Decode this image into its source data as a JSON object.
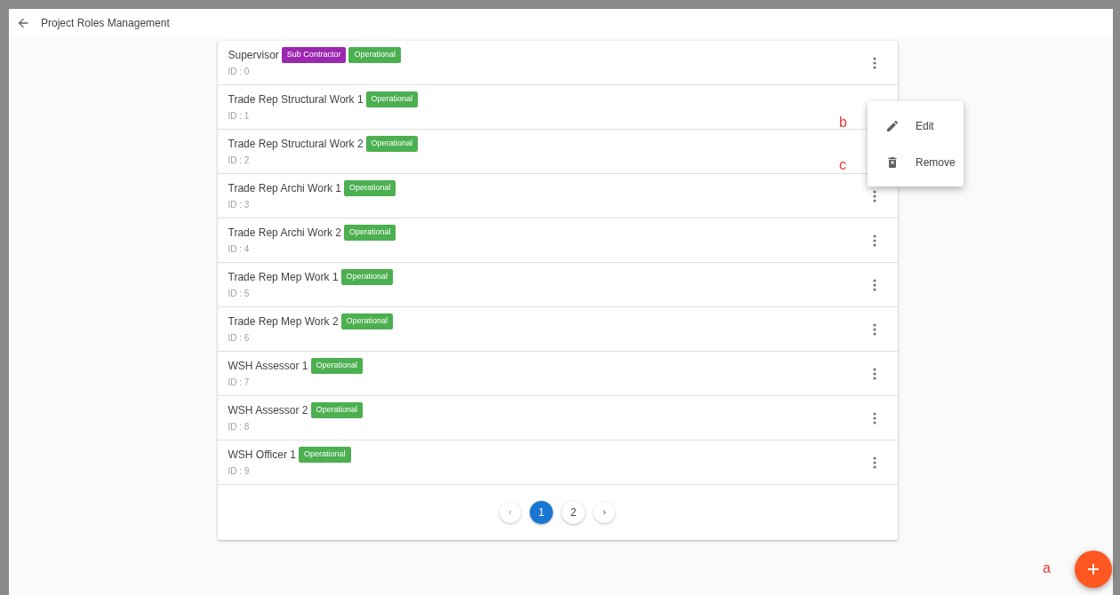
{
  "header": {
    "title": "Project Roles Management"
  },
  "roles": [
    {
      "name": "Supervisor",
      "id_label": "ID : 0",
      "kebab_visible": true,
      "tags": [
        {
          "label": "Sub Contractor",
          "color": "#9c27b0"
        },
        {
          "label": "Operational",
          "color": "#4caf50"
        }
      ]
    },
    {
      "name": "Trade Rep Structural Work 1",
      "id_label": "ID : 1",
      "kebab_visible": false,
      "tags": [
        {
          "label": "Operational",
          "color": "#4caf50"
        }
      ]
    },
    {
      "name": "Trade Rep Structural Work 2",
      "id_label": "ID : 2",
      "kebab_visible": false,
      "tags": [
        {
          "label": "Operational",
          "color": "#4caf50"
        }
      ]
    },
    {
      "name": "Trade Rep Archi Work 1",
      "id_label": "ID : 3",
      "kebab_visible": true,
      "tags": [
        {
          "label": "Operational",
          "color": "#4caf50"
        }
      ]
    },
    {
      "name": "Trade Rep Archi Work 2",
      "id_label": "ID : 4",
      "kebab_visible": true,
      "tags": [
        {
          "label": "Operational",
          "color": "#4caf50"
        }
      ]
    },
    {
      "name": "Trade Rep Mep Work 1",
      "id_label": "ID : 5",
      "kebab_visible": true,
      "tags": [
        {
          "label": "Operational",
          "color": "#4caf50"
        }
      ]
    },
    {
      "name": "Trade Rep Mep Work 2",
      "id_label": "ID : 6",
      "kebab_visible": true,
      "tags": [
        {
          "label": "Operational",
          "color": "#4caf50"
        }
      ]
    },
    {
      "name": "WSH Assessor 1",
      "id_label": "ID : 7",
      "kebab_visible": true,
      "tags": [
        {
          "label": "Operational",
          "color": "#4caf50"
        }
      ]
    },
    {
      "name": "WSH Assessor 2",
      "id_label": "ID : 8",
      "kebab_visible": true,
      "tags": [
        {
          "label": "Operational",
          "color": "#4caf50"
        }
      ]
    },
    {
      "name": "WSH Officer 1",
      "id_label": "ID : 9",
      "kebab_visible": true,
      "tags": [
        {
          "label": "Operational",
          "color": "#4caf50"
        }
      ]
    }
  ],
  "pagination": {
    "pages": [
      {
        "label": "1",
        "selected": true
      },
      {
        "label": "2",
        "selected": false
      }
    ]
  },
  "context_menu": {
    "items": [
      {
        "kind": "edit",
        "label": "Edit"
      },
      {
        "kind": "remove",
        "label": "Remove"
      }
    ]
  },
  "annotations": [
    {
      "kind": "fab",
      "label": "a"
    },
    {
      "kind": "edit",
      "label": "b"
    },
    {
      "kind": "remove",
      "label": "c"
    }
  ]
}
